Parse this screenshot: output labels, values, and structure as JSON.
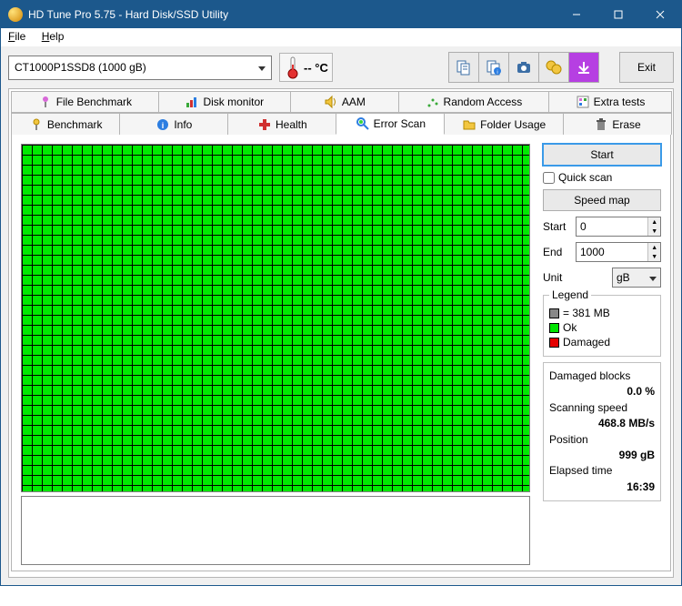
{
  "window": {
    "title": "HD Tune Pro 5.75 - Hard Disk/SSD Utility"
  },
  "menu": {
    "file": "File",
    "help": "Help"
  },
  "toolbar": {
    "drive": "CT1000P1SSD8 (1000 gB)",
    "temp": "-- °C",
    "exit": "Exit"
  },
  "tabs": {
    "fileBenchmark": "File Benchmark",
    "diskMonitor": "Disk monitor",
    "aam": "AAM",
    "randomAccess": "Random Access",
    "extraTests": "Extra tests",
    "benchmark": "Benchmark",
    "info": "Info",
    "health": "Health",
    "errorScan": "Error Scan",
    "folderUsage": "Folder Usage",
    "erase": "Erase"
  },
  "side": {
    "start": "Start",
    "quickScan": "Quick scan",
    "speedMap": "Speed map",
    "startLabel": "Start",
    "endLabel": "End",
    "unitLabel": "Unit",
    "startVal": "0",
    "endVal": "1000",
    "unitVal": "gB",
    "legendTitle": "Legend",
    "legendBlock": "= 381 MB",
    "legendOk": "Ok",
    "legendDamaged": "Damaged",
    "stats": {
      "damagedLabel": "Damaged blocks",
      "damagedVal": "0.0 %",
      "speedLabel": "Scanning speed",
      "speedVal": "468.8 MB/s",
      "posLabel": "Position",
      "posVal": "999 gB",
      "elapsedLabel": "Elapsed time",
      "elapsedVal": "16:39"
    }
  }
}
